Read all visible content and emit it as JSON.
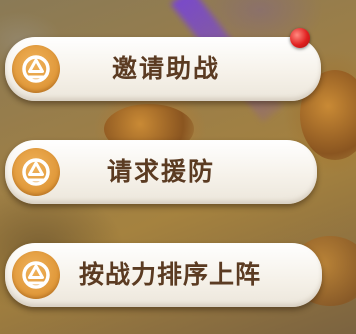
{
  "menu": {
    "buttons": [
      {
        "label": "邀请助战",
        "icon": "battle-emblem-icon",
        "has_notification": true
      },
      {
        "label": "请求援防",
        "icon": "battle-emblem-icon",
        "has_notification": false
      },
      {
        "label": "按战力排序上阵",
        "icon": "battle-emblem-icon",
        "has_notification": false
      }
    ]
  },
  "colors": {
    "button_bg": "#f6f2ea",
    "icon_disc": "#e19a3c",
    "label_text": "#5b3b22",
    "notification_dot": "#e02020"
  }
}
